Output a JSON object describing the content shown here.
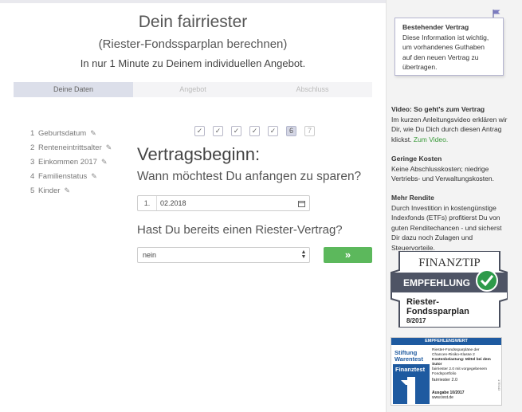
{
  "header": {
    "title": "Dein fairriester",
    "subtitle": "(Riester-Fondssparplan berechnen)",
    "tagline": "In nur 1 Minute zu Deinem individuellen Angebot."
  },
  "steps": [
    {
      "label": "Deine Daten",
      "active": true
    },
    {
      "label": "Angebot",
      "active": false
    },
    {
      "label": "Abschluss",
      "active": false
    }
  ],
  "nav": [
    {
      "num": "1",
      "label": "Geburtsdatum"
    },
    {
      "num": "2",
      "label": "Renteneintrittsalter"
    },
    {
      "num": "3",
      "label": "Einkommen 2017"
    },
    {
      "num": "4",
      "label": "Familienstatus"
    },
    {
      "num": "5",
      "label": "Kinder"
    }
  ],
  "progress": [
    "✓",
    "✓",
    "✓",
    "✓",
    "✓",
    "6",
    "7"
  ],
  "form": {
    "heading": "Vertragsbeginn:",
    "question1": "Wann möchtest Du anfangen zu sparen?",
    "date_prefix": "1.",
    "date_value": "02.2018",
    "question2": "Hast Du bereits einen Riester-Vertrag?",
    "select_value": "nein",
    "next_label": "»"
  },
  "info_box": {
    "title": "Bestehender Vertrag",
    "text": "Diese Information ist wichtig, um vorhandenes Guthaben auf den neuen Vertrag zu übertragen."
  },
  "sidebar": {
    "video": {
      "title": "Video: So geht's zum Vertrag",
      "text": "Im kurzen Anleitungsvideo erklären wir Dir, wie Du Dich durch diesen Antrag klickst.",
      "link": "Zum Video."
    },
    "costs": {
      "title": "Geringe Kosten",
      "text": "Keine Abschlusskosten; niedrige Vertriebs- und Verwaltungskosten."
    },
    "returns": {
      "title": "Mehr Rendite",
      "text": "Durch Investition in kostengünstige Indexfonds (ETFs) profitierst Du von guten Renditechancen - und sicherst Dir dazu noch Zulagen und Steuervorteile."
    }
  },
  "badge_finanztip": {
    "brand": "FINANZTIP",
    "label": "EMPFEHLUNG",
    "product_line1": "Riester-",
    "product_line2": "Fondssparplan",
    "date": "8/2017"
  },
  "badge_warentest": {
    "header": "EMPFEHLENSWERT",
    "brand1": "Stiftung",
    "brand2": "Warentest",
    "brand3": "Finanztest",
    "line1": "Riester-Fondssparpläne der",
    "line2": "Chancen-Risiko-Klasse 2",
    "line3": "Kostenbelastung: Mittel bei dem Sutor",
    "line4": "fairriester 2.0 mit vorgegebenem",
    "line5": "Fondsportfolio",
    "product": "fairriester 2.0",
    "issue": "Ausgabe 10/2017",
    "url": "www.test.de",
    "side": "17ES43"
  }
}
